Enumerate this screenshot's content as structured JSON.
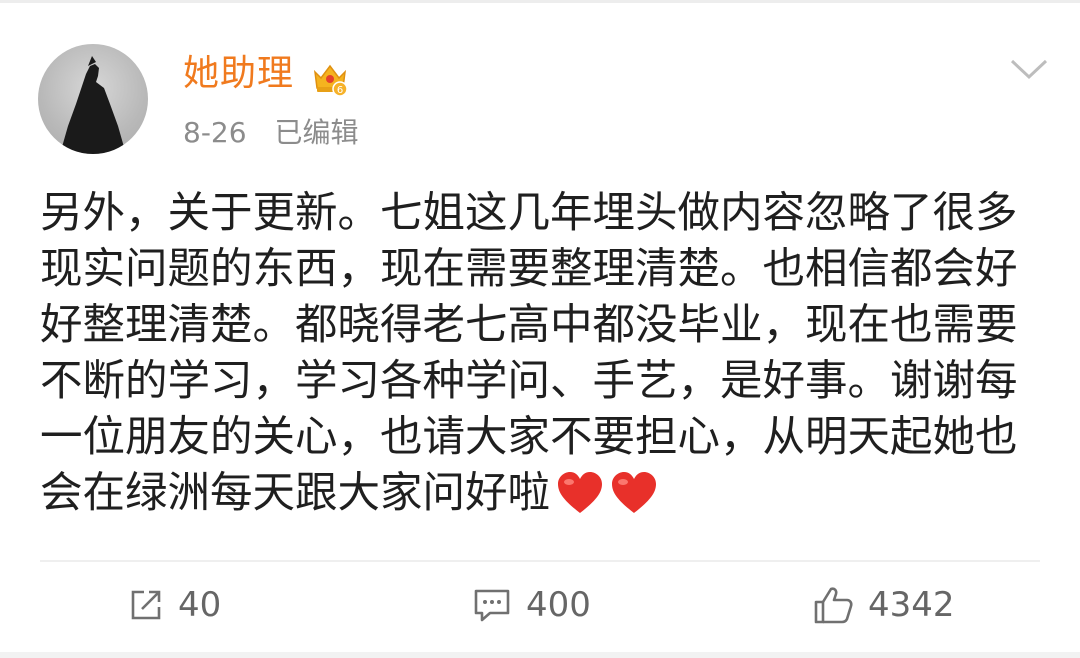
{
  "post": {
    "author": "她助理",
    "date": "8-26",
    "edited_label": "已编辑",
    "content": "另外，关于更新。七姐这几年埋头做内容忽略了很多现实问题的东西，现在需要整理清楚。也相信都会好好整理清楚。都晓得老七高中都没毕业，现在也需要不断的学习，学习各种学问、手艺，是好事。谢谢每一位朋友的关心，也请大家不要担心，从明天起她也会在绿洲每天跟大家问好啦",
    "badge_level": "6",
    "emoji": [
      "red-heart",
      "red-heart"
    ]
  },
  "actions": {
    "share_count": "40",
    "comment_count": "400",
    "like_count": "4342"
  },
  "colors": {
    "author_name": "#f07a1e",
    "meta_text": "#8c8c8c",
    "content_text": "#1f1f1f",
    "heart": "#e8302a"
  },
  "icons": [
    "avatar",
    "crown-badge-icon",
    "chevron-down-icon",
    "share-icon",
    "comment-icon",
    "like-icon",
    "heart-emoji"
  ]
}
